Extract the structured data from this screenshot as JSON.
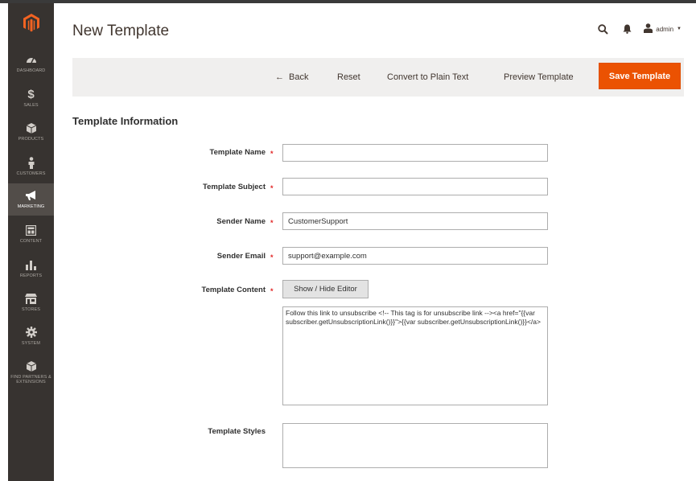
{
  "colors": {
    "accent": "#eb5202",
    "sidebar": "#373330",
    "required": "#e22626"
  },
  "header": {
    "title": "New Template",
    "user": "admin",
    "icons": [
      "search-icon",
      "bell-icon",
      "user-icon",
      "chevron-down-icon"
    ]
  },
  "sidebar": {
    "items": [
      {
        "label": "Dashboard",
        "icon": "dashboard-icon"
      },
      {
        "label": "Sales",
        "icon": "dollar-icon"
      },
      {
        "label": "Products",
        "icon": "cube-icon"
      },
      {
        "label": "Customers",
        "icon": "person-icon"
      },
      {
        "label": "Marketing",
        "icon": "megaphone-icon",
        "active": true
      },
      {
        "label": "Content",
        "icon": "layout-icon"
      },
      {
        "label": "Reports",
        "icon": "bar-chart-icon"
      },
      {
        "label": "Stores",
        "icon": "store-icon"
      },
      {
        "label": "System",
        "icon": "gear-icon"
      },
      {
        "label": "Find Partners & Extensions",
        "icon": "box-icon"
      }
    ]
  },
  "actions": {
    "back": "Back",
    "reset": "Reset",
    "convert": "Convert to Plain Text",
    "preview": "Preview Template",
    "save": "Save Template"
  },
  "form": {
    "section_title": "Template Information",
    "template_name": {
      "label": "Template Name",
      "value": ""
    },
    "template_subject": {
      "label": "Template Subject",
      "value": ""
    },
    "sender_name": {
      "label": "Sender Name",
      "value": "CustomerSupport"
    },
    "sender_email": {
      "label": "Sender Email",
      "value": "support@example.com"
    },
    "template_content": {
      "label": "Template Content",
      "toggle": "Show / Hide Editor",
      "value": "Follow this link to unsubscribe <!-- This tag is for unsubscribe link --><a href=\"{{var subscriber.getUnsubscriptionLink()}}\">{{var subscriber.getUnsubscriptionLink()}}</a>"
    },
    "template_styles": {
      "label": "Template Styles",
      "value": ""
    },
    "required_mark": "*"
  }
}
